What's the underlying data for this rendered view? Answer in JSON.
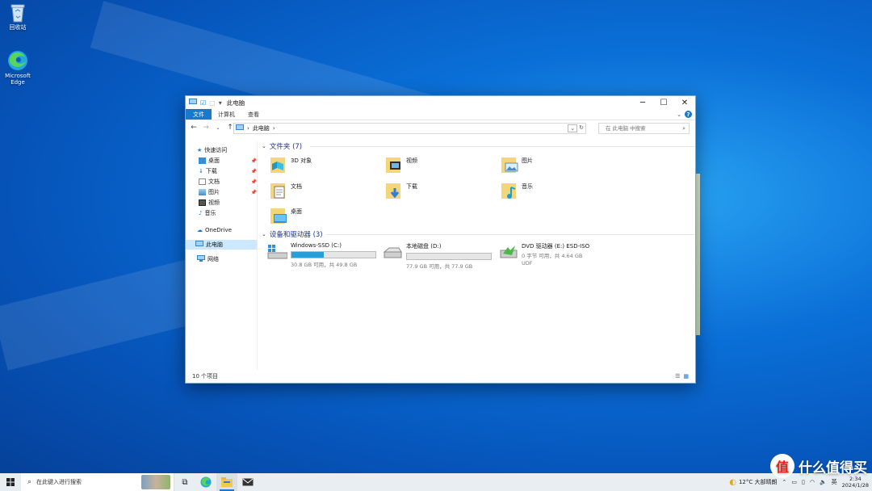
{
  "desktop": {
    "icons": [
      {
        "label": "回收站",
        "icon": "recycle-bin-icon"
      },
      {
        "label": "Microsoft Edge",
        "icon": "edge-icon"
      }
    ]
  },
  "window": {
    "title": "此电脑",
    "ribbon_tabs": [
      "文件",
      "计算机",
      "查看"
    ],
    "address_path": "此电脑",
    "search_placeholder": "在 此电脑 中搜索",
    "sidebar": {
      "quick_access": "快速访问",
      "quick_items": [
        "桌面",
        "下载",
        "文档",
        "图片",
        "视频",
        "音乐"
      ],
      "onedrive": "OneDrive",
      "this_pc": "此电脑",
      "network": "网络"
    },
    "folders_header": "文件夹 (7)",
    "folders": [
      "3D 对象",
      "视频",
      "图片",
      "文档",
      "下载",
      "音乐",
      "桌面"
    ],
    "drives_header": "设备和驱动器 (3)",
    "drives": [
      {
        "name": "Windows-SSD (C:)",
        "sub": "30.8 GB 可用，共 49.8 GB",
        "used_fraction": 0.38,
        "icon": "windows-drive-icon"
      },
      {
        "name": "本地磁盘 (D:)",
        "sub": "77.9 GB 可用，共 77.9 GB",
        "used_fraction": 0.0,
        "icon": "hard-drive-icon"
      },
      {
        "name": "DVD 驱动器 (E:) ESD-ISO",
        "sub": "0 字节 可用，共 4.64 GB",
        "sub2": "UDF",
        "icon": "dvd-drive-icon"
      }
    ],
    "status": "10 个项目"
  },
  "taskbar": {
    "search_placeholder": "在此键入进行搜索",
    "weather": "12°C  大部晴朗",
    "ime": "英",
    "time": "2:34",
    "date": "2024/1/28"
  },
  "watermark": {
    "logo": "值",
    "text": "什么值得买"
  },
  "colors": {
    "accent": "#1979ca",
    "drive_fill": "#26a0da",
    "selected": "#cce8ff",
    "header_text": "#1e3287"
  }
}
